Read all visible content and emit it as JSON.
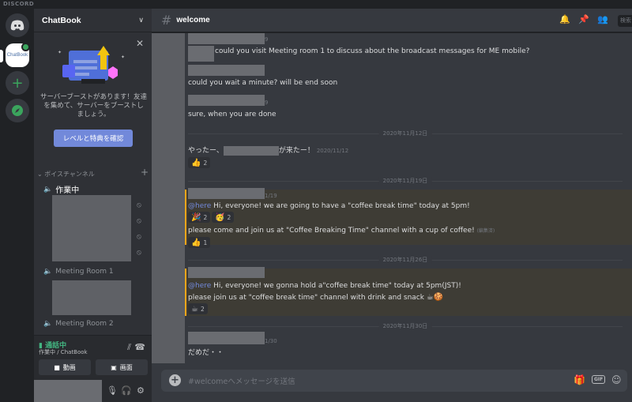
{
  "titlebar": {
    "app_name": "DISCORD"
  },
  "servers": {
    "chatbook_label": "ChatBook"
  },
  "sidebar": {
    "server_name": "ChatBook",
    "boost": {
      "text": "サーバーブーストがあります！友達を集めて、サーバーをブーストしましょう。",
      "button": "レベルと特典を確認"
    },
    "voice_category": "ボイスチャンネル",
    "voice_channels": [
      {
        "name": "作業中"
      },
      {
        "name": "Meeting Room 1"
      },
      {
        "name": "Meeting Room 2"
      }
    ],
    "voice_panel": {
      "status": "通話中",
      "subtitle": "作業中 / ChatBook",
      "video_label": "動画",
      "screen_label": "画面"
    }
  },
  "header": {
    "channel": "welcome",
    "search": "検索"
  },
  "chat": {
    "messages": [
      {
        "text": "could you visit Meeting room 1 to discuss about the broadcast messages for ME mobile?",
        "time_suffix": "9"
      },
      {
        "text": "could you wait a minute? will be end soon"
      },
      {
        "text": "sure, when you are done",
        "time_suffix": "9"
      },
      {
        "text_before": "やったー、",
        "text_after": "が来たー！",
        "time": "2020/11/12"
      },
      {
        "mention": "@here",
        "text": "Hi, everyone! we are going to have a \"coffee break time\" today at 5pm!",
        "time_suffix": "1/19"
      },
      {
        "text": "please come and join us at \"Coffee Breaking Time\" channel with a cup of coffee!",
        "edited": "(編集済)"
      },
      {
        "mention": "@here",
        "text": "Hi, everyone! we gonna hold a\"coffee break time\" today at 5pm(JST)!"
      },
      {
        "text": "please join us at \"coffee break time\" channel with drink and snack"
      },
      {
        "text": "だめだ・・",
        "time_suffix": "1/30"
      }
    ],
    "dividers": [
      "2020年11月12日",
      "2020年11月19日",
      "2020年11月26日",
      "2020年11月30日"
    ],
    "reactions": {
      "r1": {
        "emoji": "👍",
        "count": "2"
      },
      "r2": {
        "emoji": "🎉",
        "count": "2"
      },
      "r3": {
        "emoji": "🥳",
        "count": "2"
      },
      "r4": {
        "emoji": "👍",
        "count": "1"
      },
      "r5": {
        "emoji": "☕",
        "count": "2"
      }
    }
  },
  "composer": {
    "placeholder": "#welcomeへメッセージを送信",
    "gif_label": "GIF"
  },
  "colors": {
    "accent": "#7289da",
    "green": "#43b581",
    "mention_bar": "#faa61a"
  }
}
